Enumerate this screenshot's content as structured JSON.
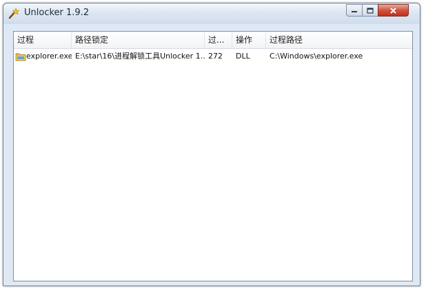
{
  "window": {
    "title": "Unlocker 1.9.2",
    "icon": "wand-icon"
  },
  "table": {
    "columns": [
      "过程",
      "路径锁定",
      "过...",
      "操作",
      "过程路径"
    ],
    "rows": [
      {
        "icon": "folder-icon",
        "process": "explorer.exe",
        "locked_path": "E:\\star\\16\\进程解锁工具Unlocker 1...",
        "pid": "272",
        "type": "DLL",
        "process_path": "C:\\Windows\\explorer.exe"
      }
    ]
  }
}
